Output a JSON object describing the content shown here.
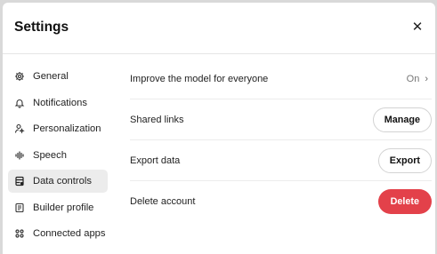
{
  "dialog": {
    "title": "Settings",
    "close_glyph": "✕"
  },
  "sidebar": {
    "items": [
      {
        "label": "General",
        "icon": "gear-icon"
      },
      {
        "label": "Notifications",
        "icon": "bell-icon"
      },
      {
        "label": "Personalization",
        "icon": "person-sparkle-icon"
      },
      {
        "label": "Speech",
        "icon": "waveform-icon"
      },
      {
        "label": "Data controls",
        "icon": "database-icon",
        "active": true
      },
      {
        "label": "Builder profile",
        "icon": "id-card-icon"
      },
      {
        "label": "Connected apps",
        "icon": "apps-grid-icon"
      }
    ]
  },
  "main": {
    "improve_model": {
      "label": "Improve the model for everyone",
      "value": "On",
      "chevron": "›"
    },
    "shared_links": {
      "label": "Shared links",
      "button": "Manage"
    },
    "export_data": {
      "label": "Export data",
      "button": "Export"
    },
    "delete_account": {
      "label": "Delete account",
      "button": "Delete"
    }
  },
  "colors": {
    "danger": "#e3414a",
    "active_bg": "#ececec"
  }
}
